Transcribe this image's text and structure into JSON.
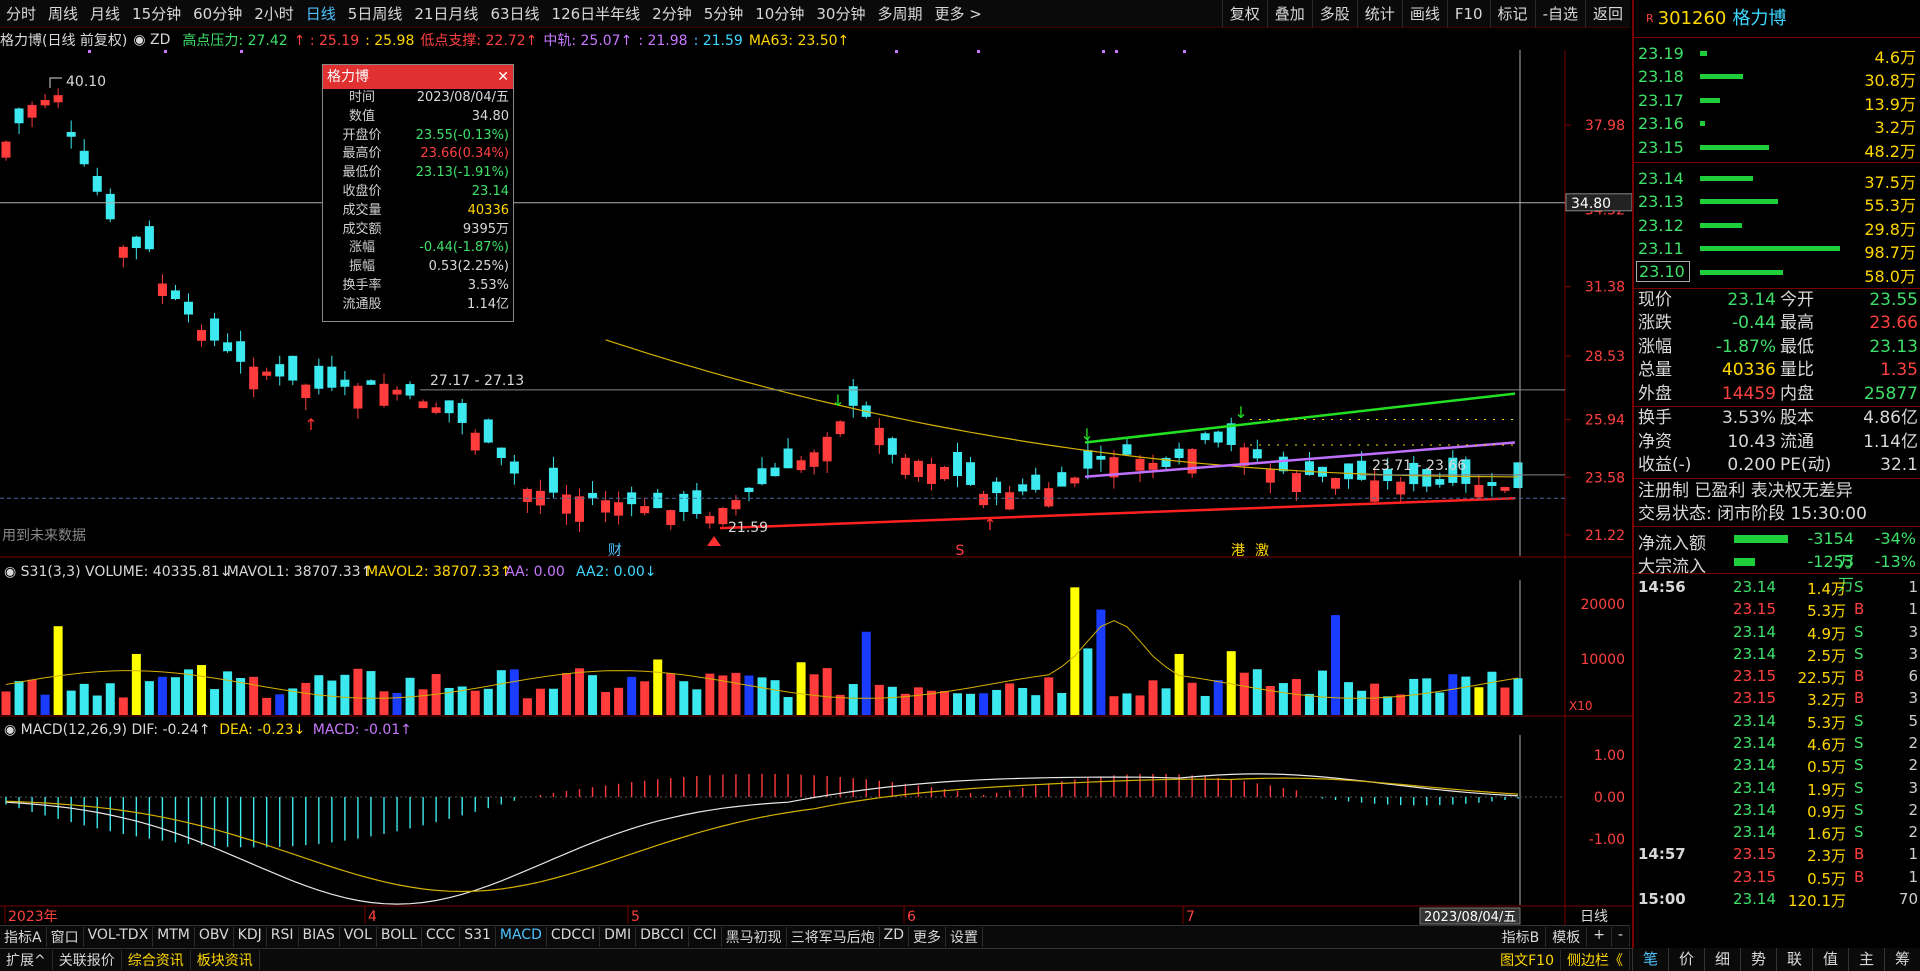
{
  "toolbar": {
    "period_tabs": [
      "分时",
      "周线",
      "月线",
      "15分钟",
      "60分钟",
      "2小时",
      "日线",
      "5日周线",
      "21日月线",
      "63日线",
      "126日半年线",
      "2分钟",
      "5分钟",
      "10分钟",
      "30分钟",
      "多周期",
      "更多 >"
    ],
    "active_index": 6,
    "right_buttons": [
      "复权",
      "叠加",
      "多股",
      "统计",
      "画线",
      "F10",
      "标记",
      "-自选",
      "返回"
    ]
  },
  "indicator_line": {
    "name": "格力博(日线 前复权)",
    "zd": "ZD",
    "items": [
      {
        "text": "高点压力: 27.42",
        "color": "#3ee06a"
      },
      {
        "text": "↑ : 25.19",
        "color": "#ff4040"
      },
      {
        "text": ": 25.98",
        "color": "#ffd700"
      },
      {
        "text": "低点支撑: 22.72↑",
        "color": "#ff4040"
      },
      {
        "text": "中轨: 25.07↑",
        "color": "#c878ff"
      },
      {
        "text": ": 21.98",
        "color": "#c878ff"
      },
      {
        "text": ": 21.59",
        "color": "#3dd9ff"
      },
      {
        "text": "MA63: 23.50↑",
        "color": "#ffd700"
      }
    ]
  },
  "tooltip": {
    "title": "格力博",
    "rows": [
      {
        "k": "时间",
        "v": "2023/08/04/五",
        "c": "#d8d8d8"
      },
      {
        "k": "数值",
        "v": "34.80",
        "c": "#d8d8d8"
      },
      {
        "k": "开盘价",
        "v": "23.55(-0.13%)",
        "c": "#3ee06a"
      },
      {
        "k": "最高价",
        "v": "23.66(0.34%)",
        "c": "#ff4040"
      },
      {
        "k": "最低价",
        "v": "23.13(-1.91%)",
        "c": "#3ee06a"
      },
      {
        "k": "收盘价",
        "v": "23.14",
        "c": "#3ee06a"
      },
      {
        "k": "成交量",
        "v": "40336",
        "c": "#ffd700"
      },
      {
        "k": "成交额",
        "v": "9395万",
        "c": "#d8d8d8"
      },
      {
        "k": "涨幅",
        "v": "-0.44(-1.87%)",
        "c": "#3ee06a"
      },
      {
        "k": "振幅",
        "v": "0.53(2.25%)",
        "c": "#d8d8d8"
      },
      {
        "k": "换手率",
        "v": "3.53%",
        "c": "#d8d8d8"
      },
      {
        "k": "流通股",
        "v": "1.14亿",
        "c": "#d8d8d8"
      }
    ]
  },
  "main_chart": {
    "price_axis": [
      37.98,
      34.52,
      31.38,
      28.53,
      25.94,
      23.58,
      21.22
    ],
    "crosshair_price": "34.80",
    "high_label": "40.10",
    "low_label": "21.59",
    "range_label_1": "27.17 - 27.13",
    "range_label_2": "23.71 - 23.66",
    "future_data_note": "用到未来数据",
    "event_labels": [
      "财",
      "S",
      "港",
      "激"
    ],
    "month_labels": [
      "2023年",
      "4",
      "5",
      "6",
      "7"
    ],
    "date_box": "2023/08/04/五",
    "period_label": "日线"
  },
  "volume_panel": {
    "header": [
      {
        "text": "S31(3,3) VOLUME: 40335.81↓",
        "color": "#d8d8d8"
      },
      {
        "text": "MAVOL1: 38707.33↑",
        "color": "#d8d8d8"
      },
      {
        "text": "MAVOL2: 38707.33↑",
        "color": "#ffd700"
      },
      {
        "text": "AA: 0.00",
        "color": "#c878ff"
      },
      {
        "text": "AA2: 0.00↓",
        "color": "#3dd9ff"
      }
    ],
    "axis": [
      "20000",
      "10000"
    ],
    "unit": "X10"
  },
  "macd_panel": {
    "header": [
      {
        "text": "MACD(12,26,9) DIF: -0.24↑",
        "color": "#d8d8d8"
      },
      {
        "text": "DEA: -0.23↓",
        "color": "#ffd700"
      },
      {
        "text": "MACD: -0.01↑",
        "color": "#c878ff"
      }
    ],
    "axis": [
      "1.00",
      "0.00",
      "-1.00"
    ]
  },
  "bottom_bar1": [
    "指标A",
    "窗口",
    "VOL-TDX",
    "MTM",
    "OBV",
    "KDJ",
    "RSI",
    "BIAS",
    "VOL",
    "BOLL",
    "CCC",
    "S31",
    "MACD",
    "CDCCI",
    "DMI",
    "DBCCI",
    "CCI",
    "黑马初现",
    "三将军马后炮",
    "ZD",
    "更多",
    "设置"
  ],
  "bottom_bar1_active": 12,
  "bottom_bar1_right": [
    "指标B",
    "模板",
    "+",
    "-"
  ],
  "bottom_bar2": [
    "扩展^",
    "关联报价",
    "综合资讯",
    "板块资讯"
  ],
  "bottom_bar2_right": [
    "图文F10",
    "侧边栏《"
  ],
  "right_panel": {
    "r_mark": "R",
    "code": "301260",
    "name": "格力博",
    "asks": [
      {
        "p": "23.19",
        "q": "4.6万",
        "w": 0.05
      },
      {
        "p": "23.18",
        "q": "30.8万",
        "w": 0.31
      },
      {
        "p": "23.17",
        "q": "13.9万",
        "w": 0.14
      },
      {
        "p": "23.16",
        "q": "3.2万",
        "w": 0.03
      },
      {
        "p": "23.15",
        "q": "48.2万",
        "w": 0.49
      }
    ],
    "bids": [
      {
        "p": "23.14",
        "q": "37.5万",
        "w": 0.38
      },
      {
        "p": "23.13",
        "q": "55.3万",
        "w": 0.56
      },
      {
        "p": "23.12",
        "q": "29.8万",
        "w": 0.3
      },
      {
        "p": "23.11",
        "q": "98.7万",
        "w": 1.0
      },
      {
        "p": "23.10",
        "q": "58.0万",
        "w": 0.59
      }
    ],
    "quotes": [
      [
        "现价",
        "23.14",
        "#3ee06a",
        "今开",
        "23.55",
        "#3ee06a"
      ],
      [
        "涨跌",
        "-0.44",
        "#3ee06a",
        "最高",
        "23.66",
        "#ff4040"
      ],
      [
        "涨幅",
        "-1.87%",
        "#3ee06a",
        "最低",
        "23.13",
        "#3ee06a"
      ],
      [
        "总量",
        "40336",
        "#ffd700",
        "量比",
        "1.35",
        "#ff4040"
      ],
      [
        "外盘",
        "14459",
        "#ff4040",
        "内盘",
        "25877",
        "#3ee06a"
      ]
    ],
    "stats": [
      [
        "换手",
        "3.53%",
        "#d8d8d8",
        "股本",
        "4.86亿",
        "#d8d8d8"
      ],
      [
        "净资",
        "10.43",
        "#d8d8d8",
        "流通",
        "1.14亿",
        "#d8d8d8"
      ],
      [
        "收益(-)",
        "0.200",
        "#d8d8d8",
        "PE(动)",
        "32.1",
        "#d8d8d8"
      ]
    ],
    "note1": "注册制 已盈利 表决权无差异",
    "note2": "交易状态: 闭市阶段 15:30:00",
    "flows": [
      {
        "k": "净流入额",
        "a": "-3154万",
        "b": "-34%",
        "w": 0.9
      },
      {
        "k": "大宗流入",
        "a": "-1253万",
        "b": "-13%",
        "w": 0.35
      }
    ],
    "ticks": [
      {
        "t": "14:56",
        "p": "23.14",
        "v": "1.4万",
        "s": "S",
        "n": "1"
      },
      {
        "t": "",
        "p": "23.15",
        "v": "5.3万",
        "s": "B",
        "n": "1"
      },
      {
        "t": "",
        "p": "23.14",
        "v": "4.9万",
        "s": "S",
        "n": "3"
      },
      {
        "t": "",
        "p": "23.14",
        "v": "2.5万",
        "s": "S",
        "n": "3"
      },
      {
        "t": "",
        "p": "23.15",
        "v": "22.5万",
        "s": "B",
        "n": "6"
      },
      {
        "t": "",
        "p": "23.15",
        "v": "3.2万",
        "s": "B",
        "n": "3"
      },
      {
        "t": "",
        "p": "23.14",
        "v": "5.3万",
        "s": "S",
        "n": "5"
      },
      {
        "t": "",
        "p": "23.14",
        "v": "4.6万",
        "s": "S",
        "n": "2"
      },
      {
        "t": "",
        "p": "23.14",
        "v": "0.5万",
        "s": "S",
        "n": "2"
      },
      {
        "t": "",
        "p": "23.14",
        "v": "1.9万",
        "s": "S",
        "n": "3"
      },
      {
        "t": "",
        "p": "23.14",
        "v": "0.9万",
        "s": "S",
        "n": "2"
      },
      {
        "t": "",
        "p": "23.14",
        "v": "1.6万",
        "s": "S",
        "n": "2"
      },
      {
        "t": "14:57",
        "p": "23.15",
        "v": "2.3万",
        "s": "B",
        "n": "1"
      },
      {
        "t": "",
        "p": "23.15",
        "v": "0.5万",
        "s": "B",
        "n": "1"
      },
      {
        "t": "15:00",
        "p": "23.14",
        "v": "120.1万",
        "s": "",
        "n": "70"
      }
    ],
    "tabs": [
      "笔",
      "价",
      "细",
      "势",
      "联",
      "值",
      "主",
      "筹"
    ]
  },
  "colors": {
    "up": "#ff3b3b",
    "down": "#3ce9ef",
    "ma": "#d4b000",
    "green_line": "#22e022",
    "purple_line": "#c070ff",
    "red_line": "#ff2020"
  }
}
